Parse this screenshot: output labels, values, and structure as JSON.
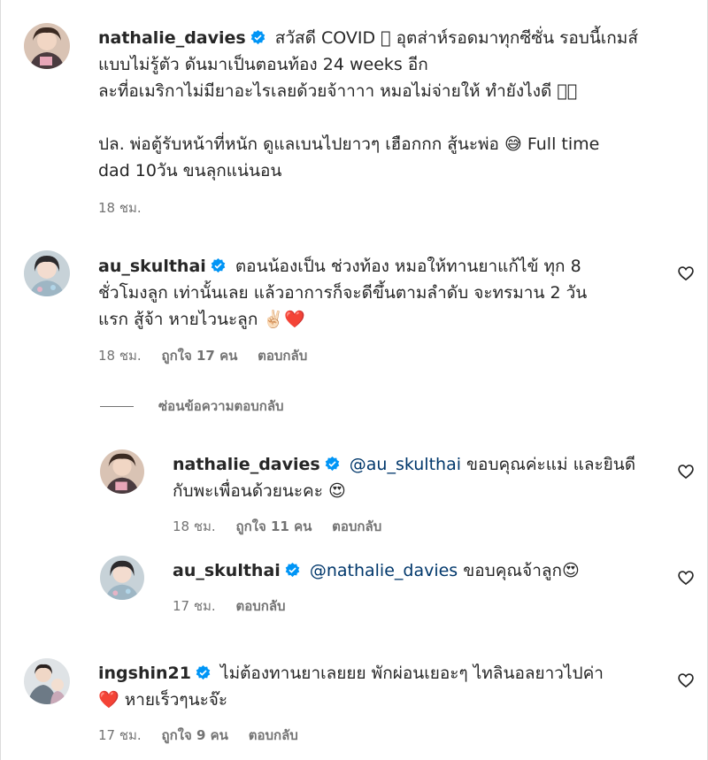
{
  "comments": [
    {
      "username": "nathalie_davies",
      "lines": [
        "สวัสดี COVID 󾌴 อุตส่าห์รอดมาทุกซีซั่น รอบนี้เกมส์",
        "แบบไม่รู้ตัว ดันมาเป็นตอนท้อง 24 weeks อีก",
        "ละที่อเมริกาไม่มียาอะไรเลยด้วยจ้าาาา หมอไม่จ่ายให้ ทำยังไงดี 󾌴󾌴",
        "ปล. พ่อตู้รับหน้าที่หนัก ดูแลเบนไปยาวๆ เฮือกกก สู้นะพ่อ 😅 Full time",
        "dad 10วัน ขนลุกแน่นอน"
      ],
      "time": "18 ชม."
    },
    {
      "username": "au_skulthai",
      "lines": [
        "ตอนน้องเป็น ช่วงท้อง หมอให้ทานยาแก้ไข้ ทุก 8",
        "ชั่วโมงลูก เท่านั้นเลย แล้วอาการก็จะดีขึ้นตามลำดับ จะทรมาน 2 วัน",
        "แรก สู้จ้า หายไวนะลูก ✌🏻❤️"
      ],
      "time": "18 ชม.",
      "likes": "ถูกใจ 17 คน",
      "reply": "ตอบกลับ"
    }
  ],
  "hide_replies_label": "ซ่อนข้อความตอบกลับ",
  "replies": [
    {
      "username": "nathalie_davies",
      "mention": "@au_skulthai",
      "lines": [
        " ขอบคุณค่ะแม่ และยินดี",
        "กับพะเพื่อนด้วยนะคะ 😍"
      ],
      "time": "18 ชม.",
      "likes": "ถูกใจ 11 คน",
      "reply": "ตอบกลับ"
    },
    {
      "username": "au_skulthai",
      "mention": "@nathalie_davies",
      "lines": [
        " ขอบคุณจ้าลูก😍"
      ],
      "time": "17 ชม.",
      "reply": "ตอบกลับ"
    }
  ],
  "last_comment": {
    "username": "ingshin21",
    "lines": [
      "ไม่ต้องทานยาเลยยย พักผ่อนเยอะๆ ไทลินอลยาวไปค่า",
      "❤️ หายเร็วๆนะจ๊ะ"
    ],
    "time": "17 ชม.",
    "likes": "ถูกใจ 9 คน",
    "reply": "ตอบกลับ"
  },
  "colors": {
    "verified": "#0095f6",
    "mention": "#00376b",
    "meta": "#737373",
    "text": "#262626"
  },
  "icons": {
    "verified": "verified-badge-icon",
    "like": "heart-outline-icon"
  }
}
